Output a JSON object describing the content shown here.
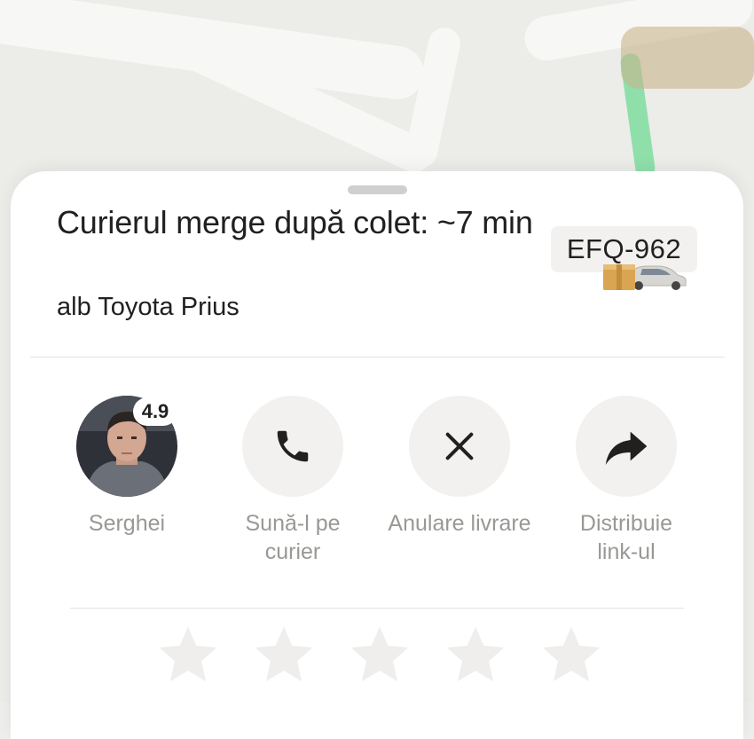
{
  "status": {
    "title": "Curierul merge după colet: ~7 min",
    "car_description": "alb Toyota Prius",
    "plate": "EFQ-962"
  },
  "courier": {
    "name": "Serghei",
    "rating": "4.9"
  },
  "actions": {
    "call_label": "Sună-l pe curier",
    "cancel_label": "Anulare livrare",
    "share_label": "Distribuie link-ul"
  },
  "rating_stars": {
    "count": 5,
    "selected": 0,
    "color": "#efeeec"
  },
  "colors": {
    "sheet_bg": "#ffffff",
    "text_primary": "#21201f",
    "text_secondary": "#9a9894",
    "chip_bg": "#f2f1ef",
    "route": "#7fdda0"
  },
  "icons": [
    "phone-icon",
    "close-icon",
    "share-arrow-icon",
    "star-icon",
    "car-icon",
    "package-icon"
  ]
}
